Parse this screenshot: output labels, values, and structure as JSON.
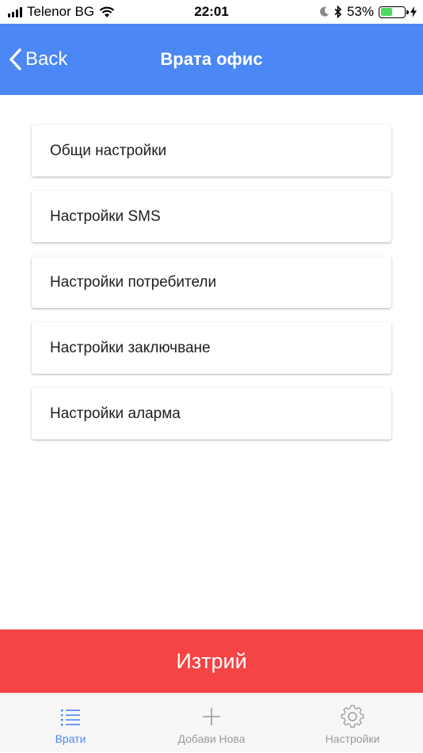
{
  "status_bar": {
    "carrier": "Telenor BG",
    "time": "22:01",
    "battery_percent": "53%",
    "battery_level": 0.53,
    "icons": [
      "signal-icon",
      "wifi-icon",
      "moon-icon",
      "bluetooth-icon",
      "battery-icon",
      "charging-icon"
    ]
  },
  "nav": {
    "back_label": "Back",
    "title": "Врата офис",
    "color": "#4b87f5"
  },
  "menu": {
    "items": [
      {
        "label": "Общи настройки"
      },
      {
        "label": "Настройки SMS"
      },
      {
        "label": "Настройки потребители"
      },
      {
        "label": "Настройки заключване"
      },
      {
        "label": "Настройки аларма"
      }
    ]
  },
  "delete": {
    "label": "Изтрий",
    "color": "#f44444"
  },
  "tabs": [
    {
      "label": "Врати",
      "icon": "list-icon",
      "active": true
    },
    {
      "label": "Добави Нова",
      "icon": "plus-icon",
      "active": false
    },
    {
      "label": "Настройки",
      "icon": "gear-icon",
      "active": false
    }
  ]
}
